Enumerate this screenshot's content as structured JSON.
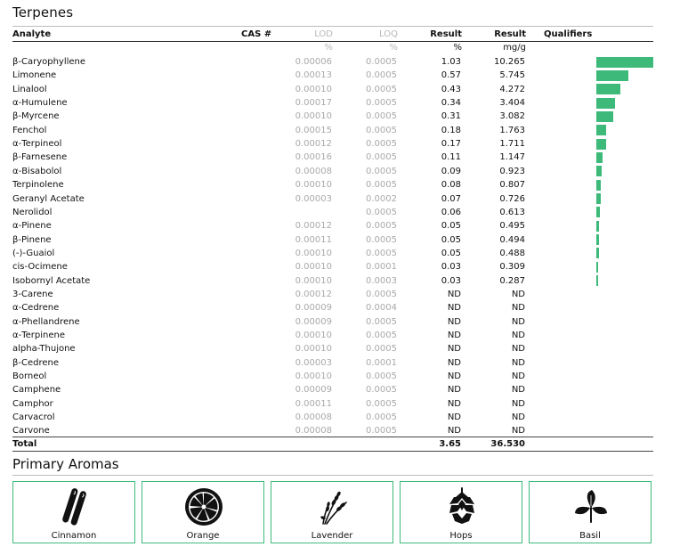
{
  "section_title": "Terpenes",
  "columns": {
    "analyte": "Analyte",
    "cas": "CAS #",
    "lod": "LOD",
    "loq": "LOQ",
    "result_pct": "Result",
    "result_mg": "Result",
    "qualifiers": "Qualifiers"
  },
  "units": {
    "lod": "%",
    "loq": "%",
    "result_pct": "%",
    "result_mg": "mg/g"
  },
  "rows": [
    {
      "name": "β-Caryophyllene",
      "lod": "0.00006",
      "loq": "0.0005",
      "pct": "1.03",
      "mg": "10.265",
      "bar": 10.265
    },
    {
      "name": "Limonene",
      "lod": "0.00013",
      "loq": "0.0005",
      "pct": "0.57",
      "mg": "5.745",
      "bar": 5.745
    },
    {
      "name": "Linalool",
      "lod": "0.00010",
      "loq": "0.0005",
      "pct": "0.43",
      "mg": "4.272",
      "bar": 4.272
    },
    {
      "name": "α-Humulene",
      "lod": "0.00017",
      "loq": "0.0005",
      "pct": "0.34",
      "mg": "3.404",
      "bar": 3.404
    },
    {
      "name": "β-Myrcene",
      "lod": "0.00010",
      "loq": "0.0005",
      "pct": "0.31",
      "mg": "3.082",
      "bar": 3.082
    },
    {
      "name": "Fenchol",
      "lod": "0.00015",
      "loq": "0.0005",
      "pct": "0.18",
      "mg": "1.763",
      "bar": 1.763
    },
    {
      "name": "α-Terpineol",
      "lod": "0.00012",
      "loq": "0.0005",
      "pct": "0.17",
      "mg": "1.711",
      "bar": 1.711
    },
    {
      "name": "β-Farnesene",
      "lod": "0.00016",
      "loq": "0.0005",
      "pct": "0.11",
      "mg": "1.147",
      "bar": 1.147
    },
    {
      "name": "α-Bisabolol",
      "lod": "0.00008",
      "loq": "0.0005",
      "pct": "0.09",
      "mg": "0.923",
      "bar": 0.923
    },
    {
      "name": "Terpinolene",
      "lod": "0.00010",
      "loq": "0.0005",
      "pct": "0.08",
      "mg": "0.807",
      "bar": 0.807
    },
    {
      "name": "Geranyl Acetate",
      "lod": "0.00003",
      "loq": "0.0002",
      "pct": "0.07",
      "mg": "0.726",
      "bar": 0.726
    },
    {
      "name": "Nerolidol",
      "lod": "",
      "loq": "0.0005",
      "pct": "0.06",
      "mg": "0.613",
      "bar": 0.613
    },
    {
      "name": "α-Pinene",
      "lod": "0.00012",
      "loq": "0.0005",
      "pct": "0.05",
      "mg": "0.495",
      "bar": 0.495
    },
    {
      "name": "β-Pinene",
      "lod": "0.00011",
      "loq": "0.0005",
      "pct": "0.05",
      "mg": "0.494",
      "bar": 0.494
    },
    {
      "name": "(-)-Guaiol",
      "lod": "0.00010",
      "loq": "0.0005",
      "pct": "0.05",
      "mg": "0.488",
      "bar": 0.488
    },
    {
      "name": "cis-Ocimene",
      "lod": "0.00010",
      "loq": "0.0001",
      "pct": "0.03",
      "mg": "0.309",
      "bar": 0.309
    },
    {
      "name": "Isobornyl Acetate",
      "lod": "0.00010",
      "loq": "0.0003",
      "pct": "0.03",
      "mg": "0.287",
      "bar": 0.287
    },
    {
      "name": "3-Carene",
      "lod": "0.00012",
      "loq": "0.0005",
      "pct": "ND",
      "mg": "ND",
      "bar": 0
    },
    {
      "name": "α-Cedrene",
      "lod": "0.00009",
      "loq": "0.0004",
      "pct": "ND",
      "mg": "ND",
      "bar": 0
    },
    {
      "name": "α-Phellandrene",
      "lod": "0.00009",
      "loq": "0.0005",
      "pct": "ND",
      "mg": "ND",
      "bar": 0
    },
    {
      "name": "α-Terpinene",
      "lod": "0.00010",
      "loq": "0.0005",
      "pct": "ND",
      "mg": "ND",
      "bar": 0
    },
    {
      "name": "alpha-Thujone",
      "lod": "0.00010",
      "loq": "0.0005",
      "pct": "ND",
      "mg": "ND",
      "bar": 0
    },
    {
      "name": "β-Cedrene",
      "lod": "0.00003",
      "loq": "0.0001",
      "pct": "ND",
      "mg": "ND",
      "bar": 0
    },
    {
      "name": "Borneol",
      "lod": "0.00010",
      "loq": "0.0005",
      "pct": "ND",
      "mg": "ND",
      "bar": 0
    },
    {
      "name": "Camphene",
      "lod": "0.00009",
      "loq": "0.0005",
      "pct": "ND",
      "mg": "ND",
      "bar": 0
    },
    {
      "name": "Camphor",
      "lod": "0.00011",
      "loq": "0.0005",
      "pct": "ND",
      "mg": "ND",
      "bar": 0
    },
    {
      "name": "Carvacrol",
      "lod": "0.00008",
      "loq": "0.0005",
      "pct": "ND",
      "mg": "ND",
      "bar": 0
    },
    {
      "name": "Carvone",
      "lod": "0.00008",
      "loq": "0.0005",
      "pct": "ND",
      "mg": "ND",
      "bar": 0
    }
  ],
  "total": {
    "label": "Total",
    "pct": "3.65",
    "mg": "36.530"
  },
  "bar_color": "#3dba7a",
  "aromas": {
    "title": "Primary Aromas",
    "items": [
      {
        "label": "Cinnamon",
        "icon": "cinnamon-icon"
      },
      {
        "label": "Orange",
        "icon": "orange-icon"
      },
      {
        "label": "Lavender",
        "icon": "lavender-icon"
      },
      {
        "label": "Hops",
        "icon": "hops-icon"
      },
      {
        "label": "Basil",
        "icon": "basil-icon"
      }
    ]
  }
}
